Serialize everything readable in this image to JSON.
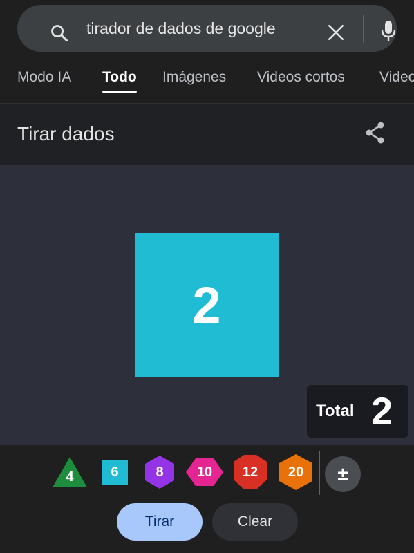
{
  "search": {
    "query": "tirador de dados de google"
  },
  "tabs": [
    {
      "label": "Modo IA"
    },
    {
      "label": "Todo"
    },
    {
      "label": "Imágenes"
    },
    {
      "label": "Videos cortos"
    },
    {
      "label": "Videos"
    }
  ],
  "widget": {
    "title": "Tirar dados",
    "result_value": "2",
    "total_label": "Total",
    "total_value": "2",
    "dice": [
      {
        "label": "4",
        "color": "#1e8e3e",
        "icon": "d4-triangle"
      },
      {
        "label": "6",
        "color": "#1fbcd4",
        "icon": "d6-square"
      },
      {
        "label": "8",
        "color": "#9334e6",
        "icon": "d8-hexagon"
      },
      {
        "label": "10",
        "color": "#e52592",
        "icon": "d10-hexagon"
      },
      {
        "label": "12",
        "color": "#d93025",
        "icon": "d12-octagon"
      },
      {
        "label": "20",
        "color": "#e8710a",
        "icon": "d20-hexagon"
      }
    ],
    "modifier_label": "±",
    "roll_label": "Tirar",
    "clear_label": "Clear"
  },
  "colors": {
    "result_die": "#1fbcd4",
    "roll_button": "#a8c7fa",
    "background": "#1f1f1f"
  }
}
